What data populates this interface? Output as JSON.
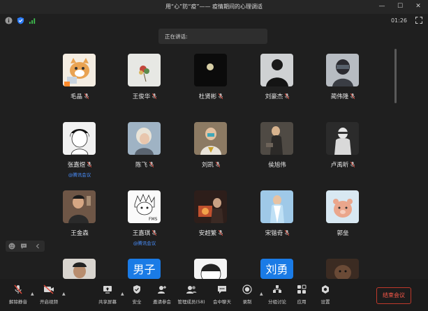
{
  "window": {
    "title": "用“心”防“疫”—— 疫情期间的心理调适"
  },
  "status": {
    "timer": "01:26"
  },
  "speaking": {
    "label": "正在讲话:"
  },
  "participants": [
    {
      "name": "毛晶",
      "tag": ""
    },
    {
      "name": "王俊华",
      "tag": ""
    },
    {
      "name": "杜贤彬",
      "tag": ""
    },
    {
      "name": "刘豪杰",
      "tag": ""
    },
    {
      "name": "蔺伟隆",
      "tag": ""
    },
    {
      "name": "张嘉煜",
      "tag": "@腾讯会议"
    },
    {
      "name": "陈飞",
      "tag": ""
    },
    {
      "name": "刘凯",
      "tag": ""
    },
    {
      "name": "侯旭伟",
      "tag": ""
    },
    {
      "name": "卢禹昕",
      "tag": ""
    },
    {
      "name": "王金森",
      "tag": ""
    },
    {
      "name": "王嘉琪",
      "tag": "@腾讯会议"
    },
    {
      "name": "安超繁",
      "tag": ""
    },
    {
      "name": "宋锴奇",
      "tag": ""
    },
    {
      "name": "郭垒",
      "tag": ""
    },
    {
      "name": "",
      "tag": ""
    },
    {
      "name": "",
      "tag": "",
      "avatar_text": "男子"
    },
    {
      "name": "",
      "tag": ""
    },
    {
      "name": "",
      "tag": "",
      "avatar_text": "刘勇"
    },
    {
      "name": "",
      "tag": ""
    }
  ],
  "toolbar": {
    "unmute": "解除静音",
    "start_video": "开启视频",
    "share_screen": "共享屏幕",
    "security": "安全",
    "invite": "邀请参会",
    "members": "管理成员(58)",
    "chat": "会中聊天",
    "record": "录制",
    "breakout": "分组讨论",
    "apps": "应用",
    "settings": "设置",
    "end": "结束会议"
  },
  "colors": {
    "accent_blue": "#4a90ff",
    "end_red": "#ff5a4a",
    "background": "#1f1f1f"
  }
}
